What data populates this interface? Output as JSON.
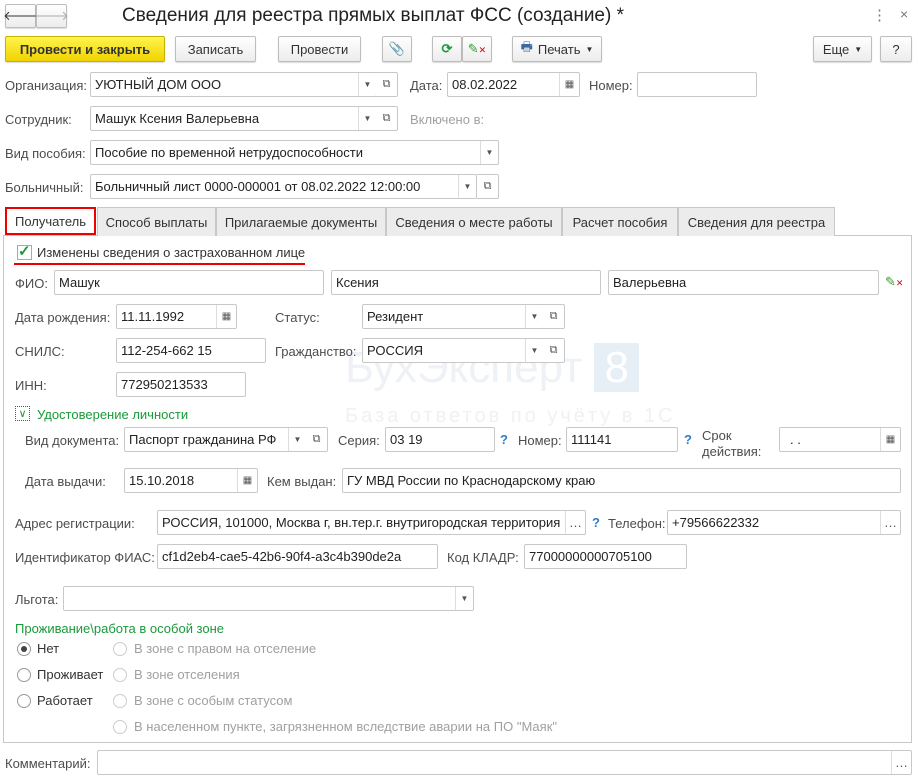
{
  "window": {
    "title": "Сведения для реестра прямых выплат ФСС (создание) *",
    "menu_icon": "kebab-icon",
    "close": "×"
  },
  "toolbar": {
    "post_close": "Провести и закрыть",
    "save": "Записать",
    "post": "Провести",
    "print": "Печать",
    "more": "Еще",
    "help": "?"
  },
  "header": {
    "org_label": "Организация:",
    "org_value": "УЮТНЫЙ ДОМ ООО",
    "date_label": "Дата:",
    "date_value": "08.02.2022",
    "number_label": "Номер:",
    "number_value": "",
    "employee_label": "Сотрудник:",
    "employee_value": "Машук Ксения Валерьевна",
    "included_label": "Включено в:",
    "benefit_label": "Вид пособия:",
    "benefit_value": "Пособие по временной нетрудоспособности",
    "sick_label": "Больничный:",
    "sick_value": "Больничный лист 0000-000001 от 08.02.2022 12:00:00"
  },
  "tabs": [
    "Получатель",
    "Способ выплаты",
    "Прилагаемые документы",
    "Сведения о месте работы",
    "Расчет пособия",
    "Сведения для реестра"
  ],
  "recipient": {
    "changed_label": "Изменены сведения о застрахованном лице",
    "changed_checked": true,
    "fio_label": "ФИО:",
    "last_name": "Машук",
    "first_name": "Ксения",
    "patronymic": "Валерьевна",
    "birth_label": "Дата рождения:",
    "birth_value": "11.11.1992",
    "status_label": "Статус:",
    "status_value": "Резидент",
    "snils_label": "СНИЛС:",
    "snils_value": "112-254-662 15",
    "citizenship_label": "Гражданство:",
    "citizenship_value": "РОССИЯ",
    "inn_label": "ИНН:",
    "inn_value": "772950213533",
    "id_group": "Удостоверение личности",
    "doc_type_label": "Вид документа:",
    "doc_type_value": "Паспорт гражданина РФ",
    "series_label": "Серия:",
    "series_value": "03 19",
    "number_label": "Номер:",
    "number_value": "111141",
    "validity_label_1": "Срок",
    "validity_label_2": "действия:",
    "validity_value": " .  .",
    "issue_date_label": "Дата выдачи:",
    "issue_date_value": "15.10.2018",
    "issued_by_label": "Кем выдан:",
    "issued_by_value": "ГУ МВД России по Краснодарскому краю",
    "address_label": "Адрес регистрации:",
    "address_value": "РОССИЯ, 101000, Москва г, вн.тер.г. внутригородская территория",
    "phone_label": "Телефон:",
    "phone_value": "+79566622332",
    "fias_label": "Идентификатор ФИАС:",
    "fias_value": "cf1d2eb4-cae5-42b6-90f4-a3c4b390de2a",
    "kladr_label": "Код КЛАДР:",
    "kladr_value": "77000000000705100",
    "benefit_label": "Льгота:",
    "benefit_value": "",
    "zone_title": "Проживание\\работа в особой зоне",
    "zone_options": [
      "Нет",
      "Проживает",
      "Работает"
    ],
    "zone_selected": "Нет",
    "zone_types": [
      "В зоне с правом на отселение",
      "В зоне отселения",
      "В зоне с особым статусом",
      "В населенном пункте, загрязненном вследствие аварии на ПО \"Маяк\""
    ]
  },
  "comment": {
    "label": "Комментарий:",
    "value": ""
  },
  "watermark": {
    "brand": "БухЭксперт 8",
    "tagline": "База ответов по учёту в 1С"
  },
  "colors": {
    "primary_button": "#f5dc00",
    "highlight": "#e00000",
    "group_title": "#1a9a3a"
  }
}
